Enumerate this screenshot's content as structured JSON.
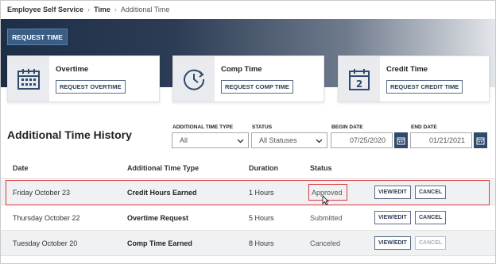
{
  "breadcrumb": {
    "items": [
      "Employee Self Service",
      "Time"
    ],
    "current": "Additional Time"
  },
  "header": {
    "request_time_label": "REQUEST TIME"
  },
  "cards": [
    {
      "title": "Overtime",
      "button": "REQUEST OVERTIME",
      "icon": "calendar-grid-icon"
    },
    {
      "title": "Comp Time",
      "button": "REQUEST COMP TIME",
      "icon": "clock-icon"
    },
    {
      "title": "Credit Time",
      "button": "REQUEST CREDIT TIME",
      "icon": "calendar-2-icon"
    }
  ],
  "history": {
    "title": "Additional Time History",
    "filters": {
      "type_label": "ADDITIONAL TIME TYPE",
      "type_value": "All",
      "status_label": "STATUS",
      "status_value": "All Statuses",
      "begin_label": "BEGIN DATE",
      "begin_value": "07/25/2020",
      "end_label": "END DATE",
      "end_value": "01/21/2021"
    },
    "columns": [
      "Date",
      "Additional Time Type",
      "Duration",
      "Status"
    ],
    "rows": [
      {
        "date": "Friday October 23",
        "type": "Credit Hours Earned",
        "duration": "1 Hours",
        "status": "Approved",
        "view": "VIEW/EDIT",
        "cancel": "CANCEL"
      },
      {
        "date": "Thursday October 22",
        "type": "Overtime Request",
        "duration": "5 Hours",
        "status": "Submitted",
        "view": "VIEW/EDIT",
        "cancel": "CANCEL"
      },
      {
        "date": "Tuesday October 20",
        "type": "Comp Time Earned",
        "duration": "8 Hours",
        "status": "Canceled",
        "view": "VIEW/EDIT",
        "cancel": "CANCEL"
      }
    ]
  },
  "colors": {
    "primary": "#2f4a6b",
    "highlight": "#d9363e"
  }
}
